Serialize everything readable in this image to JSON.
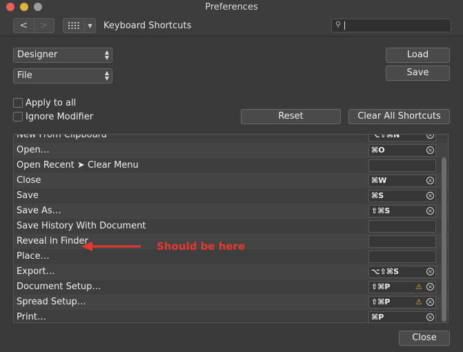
{
  "window": {
    "title": "Preferences"
  },
  "toolbar": {
    "back_label": "<",
    "forward_label": ">",
    "section_title": "Keyboard Shortcuts",
    "search_value": ""
  },
  "selects": {
    "app_value": "Designer",
    "category_value": "File"
  },
  "buttons": {
    "load": "Load",
    "save": "Save",
    "reset": "Reset",
    "clear_all": "Clear All Shortcuts",
    "close": "Close"
  },
  "checkboxes": {
    "apply_to_all": "Apply to all",
    "ignore_modifier": "Ignore Modifier"
  },
  "shortcuts": [
    {
      "name": "New From Clipboard",
      "key": "⌥⇧⌘N",
      "clearable": true,
      "warn": false
    },
    {
      "name": "Open…",
      "key": "⌘O",
      "clearable": true,
      "warn": false
    },
    {
      "name": "Open Recent ➤ Clear Menu",
      "key": "",
      "clearable": false,
      "warn": false
    },
    {
      "name": "Close",
      "key": "⌘W",
      "clearable": true,
      "warn": false
    },
    {
      "name": "Save",
      "key": "⌘S",
      "clearable": true,
      "warn": false
    },
    {
      "name": "Save As…",
      "key": "⇧⌘S",
      "clearable": true,
      "warn": false
    },
    {
      "name": "Save History With Document",
      "key": "",
      "clearable": false,
      "warn": false
    },
    {
      "name": "Reveal in Finder",
      "key": "",
      "clearable": false,
      "warn": false
    },
    {
      "name": "Place…",
      "key": "",
      "clearable": false,
      "warn": false
    },
    {
      "name": "Export…",
      "key": "⌥⇧⌘S",
      "clearable": true,
      "warn": false
    },
    {
      "name": "Document Setup…",
      "key": "⇧⌘P",
      "clearable": true,
      "warn": true
    },
    {
      "name": "Spread Setup…",
      "key": "⇧⌘P",
      "clearable": true,
      "warn": true
    },
    {
      "name": "Print…",
      "key": "⌘P",
      "clearable": true,
      "warn": false
    }
  ],
  "annotation": {
    "text": "Should be here",
    "color": "#e8382e"
  },
  "colors": {
    "background": "#3a3a3a",
    "accent_red": "#ec5f57",
    "warning": "#e5b42a"
  }
}
